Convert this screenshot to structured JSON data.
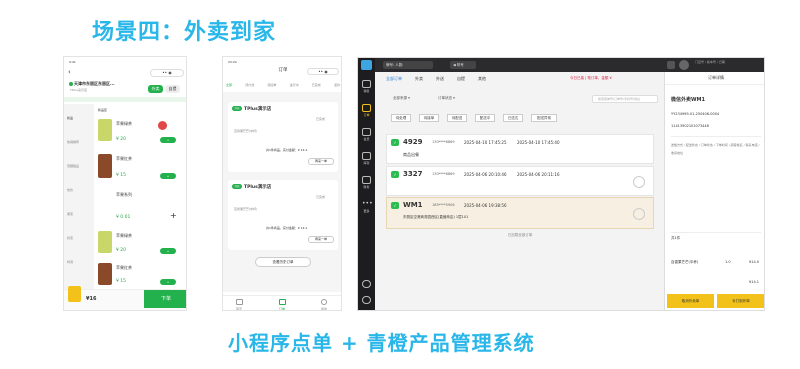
{
  "title": "场景四：外卖到家",
  "subtitle": "小程序点单 + 青橙产品管理系统",
  "phone1": {
    "address": "天津市东丽区东丽区...",
    "btn_takeaway": "外卖",
    "btn_pickup": "自提",
    "categories": [
      "新品",
      "热销推荐",
      "低糖甜品",
      "热饮",
      "果茶",
      "奶茶",
      "特调"
    ],
    "section": "新品区",
    "items": [
      {
        "name": "苹果绿茶",
        "price": "¥ 20"
      },
      {
        "name": "苹果红茶",
        "price": "¥ 15"
      },
      {
        "name": "苹果系列",
        "price": "¥ 0.01"
      },
      {
        "name": "苹果绿茶",
        "price": "¥ 20"
      },
      {
        "name": "苹果红茶",
        "price": "¥ 15"
      }
    ],
    "total": "¥16",
    "order_btn": "下单"
  },
  "phone2": {
    "header": "订单",
    "tabs": [
      "全部",
      "待付款",
      "待接单",
      "进行中",
      "已完成",
      "退款"
    ],
    "cards": [
      {
        "store": "TPlus演示店",
        "status": "已完成",
        "summary": "共1件商品，实付金额：¥ 14.1",
        "btn": "再来一单"
      },
      {
        "store": "TPlus演示店",
        "status": "已完成",
        "summary": "共1件商品，实付金额：¥ 14.1",
        "btn": "再来一单"
      }
    ],
    "history": "查看历史订单",
    "nav": [
      "首页",
      "订单",
      "我的"
    ]
  },
  "pos": {
    "tabs": [
      "全部订单",
      "外卖",
      "外送",
      "自提",
      "其他"
    ],
    "search_placeholder": "搜索取单号/订单号/手机号/地址",
    "filters": [
      "待处理",
      "待接单",
      "待配送",
      "配送中",
      "已送达",
      "配送异常"
    ],
    "orders": [
      {
        "no": "4929",
        "phone": "130****6869",
        "time1": "2025-04-10 17:45:25",
        "time2": "2025-04-10 17:45:40",
        "status": "商品出餐"
      },
      {
        "no": "3327",
        "phone": "130****6869",
        "time1": "2025-04-06 20:10:46",
        "time2": "2025-04-06 20:11:16",
        "status": ""
      },
      {
        "no": "WM1",
        "phone": "185****5906",
        "time1": "2025-04-06 19:38:56",
        "time2": "",
        "status": "东丽区空港商务园西区(直营商店) 1层101"
      }
    ],
    "load_more": "已加载全部订单",
    "sidebar": [
      "销售",
      "订单",
      "会员",
      "库存",
      "财务",
      "更多"
    ],
    "detail": {
      "header": "订单详情",
      "title": "微信外卖WM1",
      "order_no": "YY234999-01-250406-0004",
      "pay_no": "11413902101073448",
      "qty_label": "共1件",
      "item_name": "百香果芒芒(中杯)",
      "item_qty": "1.0",
      "item_price": "¥14.0",
      "total": "¥14.1",
      "btn_cancel": "取消外卖单",
      "btn_print": "补打制作单"
    }
  }
}
